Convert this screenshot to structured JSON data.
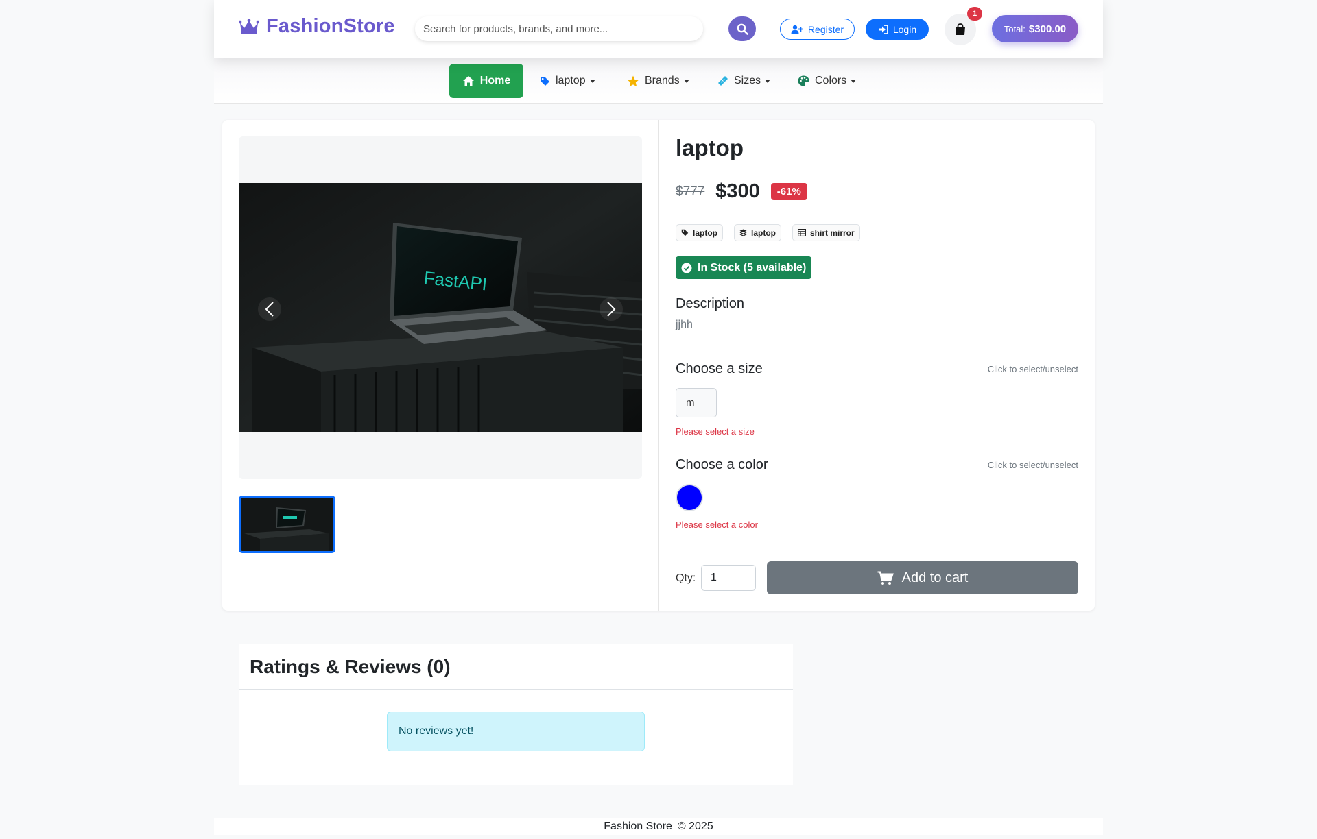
{
  "header": {
    "brand": "FashionStore",
    "search_placeholder": "Search for products, brands, and more...",
    "register_label": "Register",
    "login_label": "Login",
    "cart_count": "1",
    "total_label": "Total:",
    "total_value": "$300.00",
    "accent_color": "#6a5acd"
  },
  "nav": {
    "items": [
      {
        "label": "Home",
        "icon": "home-icon"
      },
      {
        "label": "laptop",
        "icon": "tag-icon"
      },
      {
        "label": "Brands",
        "icon": "star-icon"
      },
      {
        "label": "Sizes",
        "icon": "ruler-icon"
      },
      {
        "label": "Colors",
        "icon": "palette-icon"
      }
    ]
  },
  "product": {
    "title": "laptop",
    "old_price": "$777",
    "price": "$300",
    "discount": "-61%",
    "tags": [
      "laptop",
      "laptop",
      "shirt mirror"
    ],
    "stock": "In Stock (5 available)",
    "description_title": "Description",
    "description": "jjhh",
    "size_title": "Choose a size",
    "size_hint": "Click to select/unselect",
    "sizes": [
      "m"
    ],
    "size_error": "Please select a size",
    "color_title": "Choose a color",
    "color_hint": "Click to select/unselect",
    "colors": [
      "#0000ff"
    ],
    "color_error": "Please select a color",
    "qty_label": "Qty:",
    "qty_value": "1",
    "add_to_cart": "Add to cart",
    "image_text": "FastAPI"
  },
  "reviews": {
    "title": "Ratings & Reviews (0)",
    "empty": "No reviews yet!"
  },
  "footer": {
    "text": "Fashion Store",
    "copyright": "© 2025"
  }
}
